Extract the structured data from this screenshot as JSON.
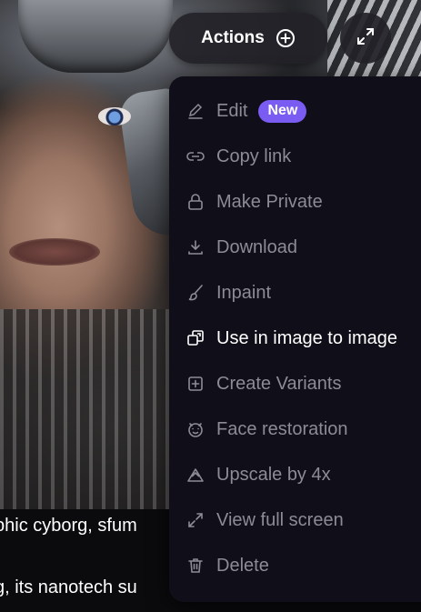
{
  "header": {
    "actions_label": "Actions"
  },
  "menu": {
    "items": [
      {
        "label": "Edit",
        "icon": "pencil-icon",
        "badge": "New"
      },
      {
        "label": "Copy link",
        "icon": "link-icon"
      },
      {
        "label": "Make Private",
        "icon": "lock-icon"
      },
      {
        "label": "Download",
        "icon": "download-icon"
      },
      {
        "label": "Inpaint",
        "icon": "brush-icon"
      },
      {
        "label": "Use in image to image",
        "icon": "image-to-image-icon"
      },
      {
        "label": "Create Variants",
        "icon": "plus-square-icon"
      },
      {
        "label": "Face restoration",
        "icon": "face-icon"
      },
      {
        "label": "Upscale by 4x",
        "icon": "upscale-icon"
      },
      {
        "label": "View full screen",
        "icon": "expand-icon"
      },
      {
        "label": "Delete",
        "icon": "trash-icon"
      }
    ]
  },
  "prompt": {
    "line1": "phic cyborg, sfum",
    "line2": "g, its nanotech su"
  },
  "colors": {
    "menu_bg": "#0f0e19",
    "muted_text": "#8d8b96",
    "badge": "#7b5cf2"
  }
}
